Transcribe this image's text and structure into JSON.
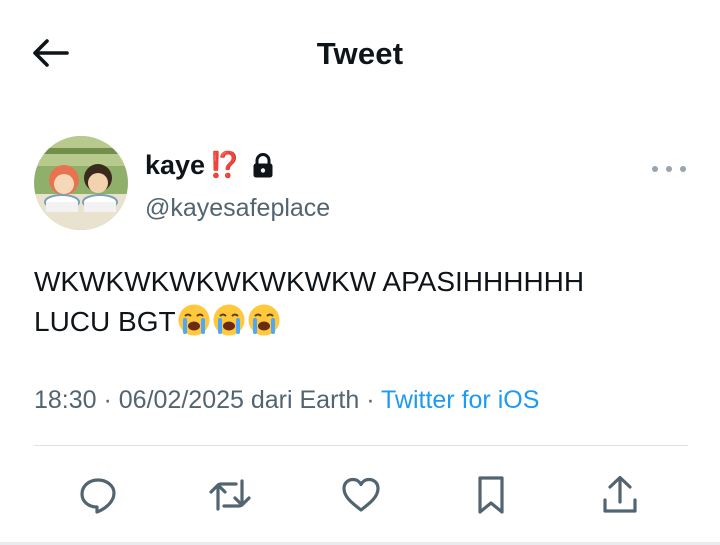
{
  "header": {
    "title": "Tweet"
  },
  "author": {
    "display_name": "kaye",
    "name_emoji": "⁉️",
    "handle": "@kayesafeplace"
  },
  "tweet": {
    "text": "WKWKWKWKWKWKWKW APASIHHHHHH\nLUCU BGT",
    "emoji_count": 3
  },
  "meta": {
    "time": "18:30",
    "separator": " · ",
    "date": "06/02/2025",
    "location": " dari Earth",
    "source": "Twitter for iOS"
  },
  "icons": {
    "back": "arrow-left-icon",
    "lock": "lock-icon",
    "more": "more-horizontal-icon",
    "reply": "reply-icon",
    "retweet": "retweet-icon",
    "like": "heart-icon",
    "bookmark": "bookmark-icon",
    "share": "share-icon"
  },
  "colors": {
    "link": "#1d9bf0",
    "secondary_text": "#536471",
    "text": "#0f1419"
  }
}
